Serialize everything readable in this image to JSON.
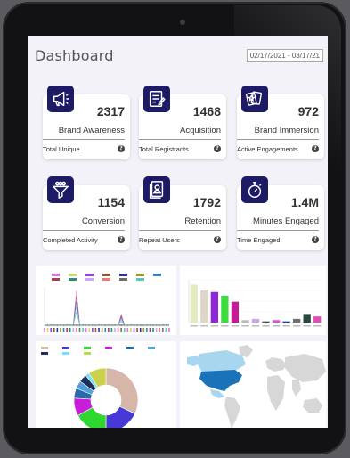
{
  "header": {
    "title": "Dashboard",
    "date_range": "02/17/2021 - 03/17/21"
  },
  "cards": [
    {
      "value": "2317",
      "name": "Brand Awareness",
      "sub": "Total Unique",
      "icon": "megaphone-icon"
    },
    {
      "value": "1468",
      "name": "Acquisition",
      "sub": "Total Registrants",
      "icon": "signup-form-icon"
    },
    {
      "value": "972",
      "name": "Brand Immersion",
      "sub": "Active Engagements",
      "icon": "cards-star-icon"
    },
    {
      "value": "1154",
      "name": "Conversion",
      "sub": "Completed Activity",
      "icon": "funnel-icon"
    },
    {
      "value": "1792",
      "name": "Retention",
      "sub": "Repeat Users",
      "icon": "user-profile-icon"
    },
    {
      "value": "1.4M",
      "name": "Minutes Engaged",
      "sub": "Time Engaged",
      "icon": "stopwatch-icon"
    }
  ],
  "colors": {
    "accent": "#1d1b66",
    "screen_bg": "#f2f2f8"
  },
  "chart_data": [
    {
      "type": "line",
      "series_colors": [
        "#e96fd8",
        "#cbd86a",
        "#9b3fd6",
        "#8a5a3b",
        "#2d2d9e",
        "#9a9a2a",
        "#3b7ec8",
        "#a04060",
        "#2d8f6b",
        "#c6a8ff",
        "#f07878",
        "#6d6d6d",
        "#56c9b5"
      ],
      "x_count": 40,
      "peaks": [
        {
          "x": 10,
          "y": 9
        },
        {
          "x": 24,
          "y": 3
        }
      ]
    },
    {
      "type": "bar",
      "values": [
        31,
        27,
        25,
        22,
        17,
        2,
        3,
        1,
        2,
        1,
        3,
        7,
        5
      ],
      "bar_colors": [
        "#e3eac0",
        "#ddd6c8",
        "#8f27d6",
        "#3fdc3f",
        "#c21e93",
        "#bcbcbc",
        "#c8a6e8",
        "#555555",
        "#e14fcf",
        "#2040c0",
        "#707070",
        "#264a3c",
        "#e04fb0"
      ]
    },
    {
      "type": "pie",
      "values": [
        32,
        18,
        17,
        9,
        5,
        4,
        4,
        2,
        9
      ],
      "slice_colors": [
        "#d5b6a9",
        "#4838d8",
        "#2ed82e",
        "#c91ed9",
        "#2b6aa8",
        "#4ea2d6",
        "#1d2d5e",
        "#7adff0",
        "#c9d24a"
      ]
    },
    {
      "type": "map",
      "highlight_color": "#1a73b8",
      "light_color": "#a8d6ef",
      "base_color": "#d7d7d7"
    }
  ]
}
